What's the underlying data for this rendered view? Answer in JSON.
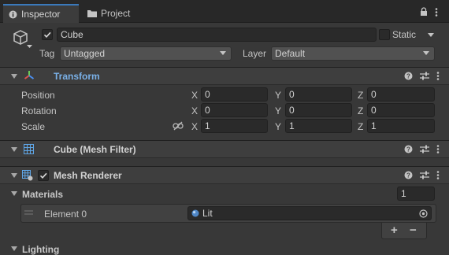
{
  "tabs": [
    {
      "label": "Inspector",
      "icon": "info-icon"
    },
    {
      "label": "Project",
      "icon": "folder-icon"
    }
  ],
  "object": {
    "name": "Cube",
    "static_label": "Static",
    "tag_label": "Tag",
    "tag_value": "Untagged",
    "layer_label": "Layer",
    "layer_value": "Default"
  },
  "transform": {
    "title": "Transform",
    "rows": [
      {
        "label": "Position",
        "x": "0",
        "y": "0",
        "z": "0"
      },
      {
        "label": "Rotation",
        "x": "0",
        "y": "0",
        "z": "0"
      },
      {
        "label": "Scale",
        "x": "1",
        "y": "1",
        "z": "1"
      }
    ],
    "axis": {
      "x": "X",
      "y": "Y",
      "z": "Z"
    }
  },
  "mesh_filter": {
    "title": "Cube (Mesh Filter)"
  },
  "mesh_renderer": {
    "title": "Mesh Renderer",
    "materials_label": "Materials",
    "materials_count": "1",
    "element_label": "Element 0",
    "element_value": "Lit",
    "add_label": "+",
    "remove_label": "−"
  },
  "lighting": {
    "label": "Lighting"
  },
  "colors": {
    "accent": "#3a79bb",
    "transform_title": "#7ab1e8",
    "background": "#383838"
  }
}
